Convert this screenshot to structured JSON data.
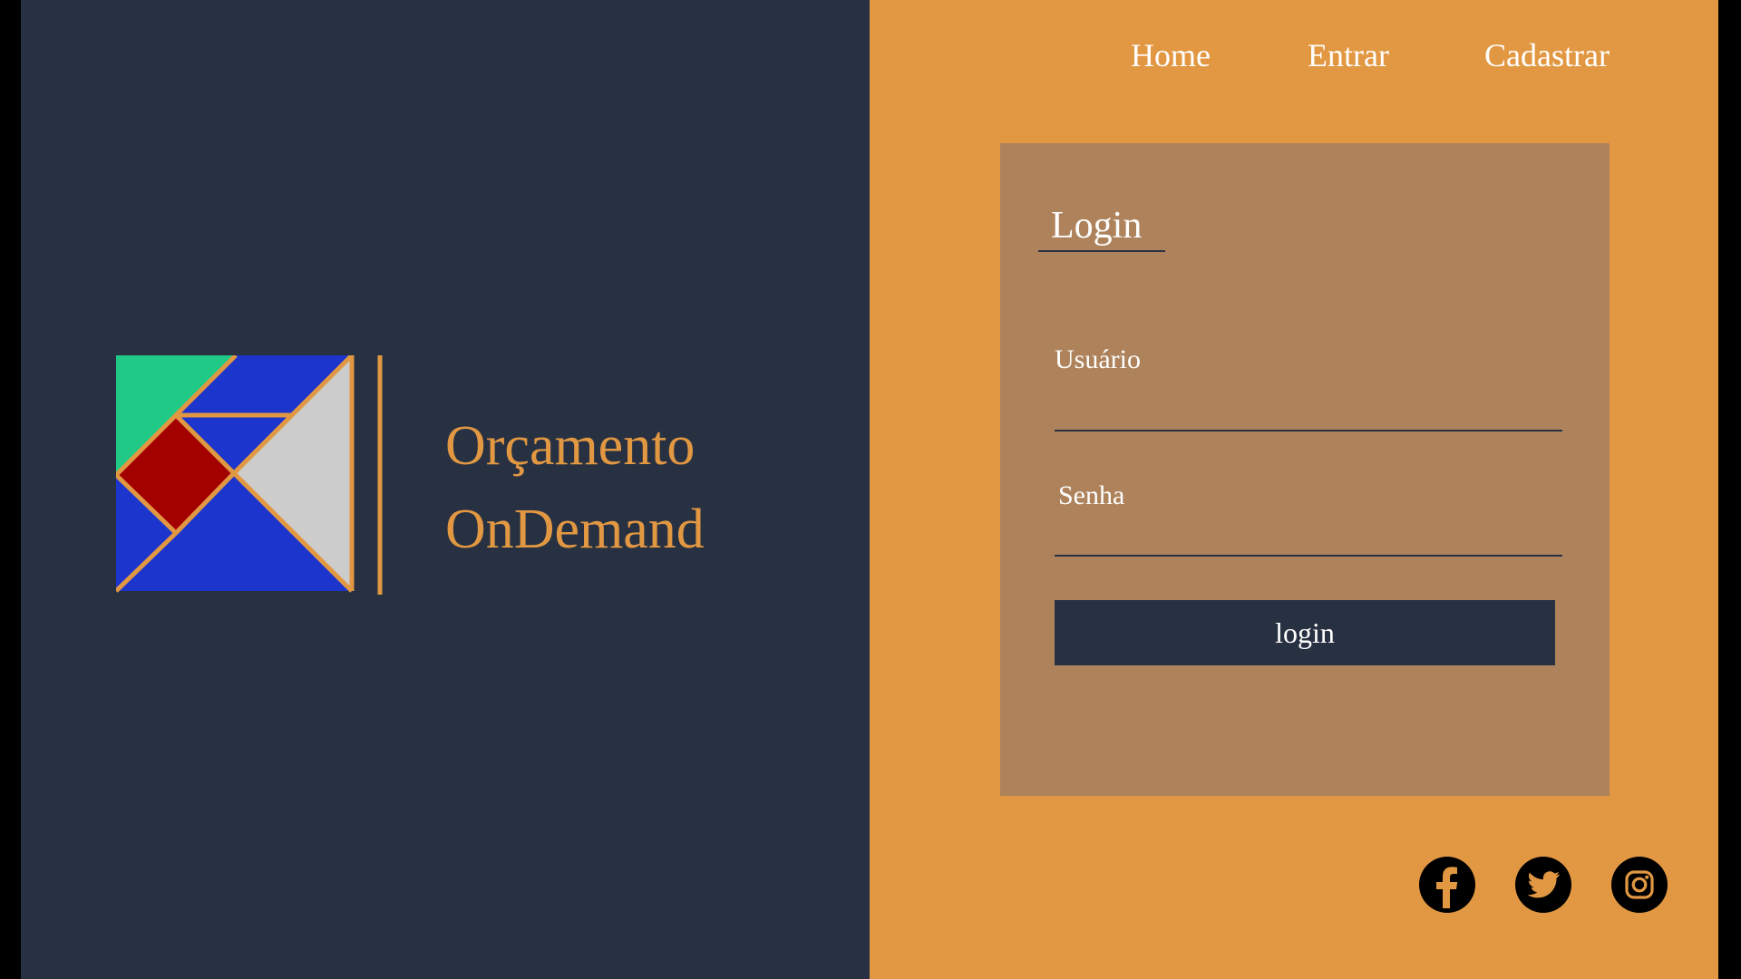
{
  "brand": {
    "line1": "Orçamento",
    "line2": "OnDemand",
    "color": "#e29842"
  },
  "nav": {
    "items": [
      {
        "label": "Home"
      },
      {
        "label": "Entrar"
      },
      {
        "label": "Cadastrar"
      }
    ]
  },
  "login_card": {
    "title": "Login",
    "username_label": "Usuário",
    "password_label": "Senha",
    "submit_label": "login"
  },
  "social": {
    "icons": [
      "facebook-icon",
      "twitter-icon",
      "instagram-icon"
    ]
  },
  "colors": {
    "left_background": "#283142",
    "right_background": "#e29842",
    "card_background": "#ae835c",
    "logo_green": "#20c985",
    "logo_blue": "#1c35cc",
    "logo_red": "#a30000",
    "logo_gray": "#cccccc"
  }
}
